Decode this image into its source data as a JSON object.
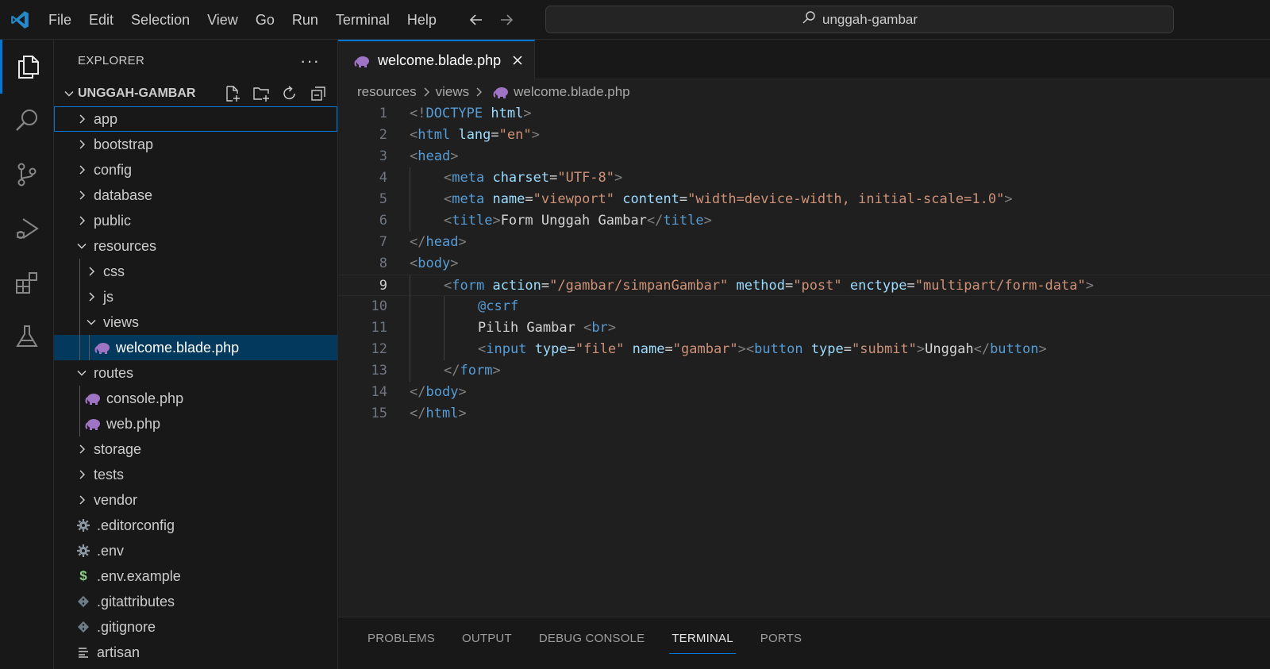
{
  "menu": [
    "File",
    "Edit",
    "Selection",
    "View",
    "Go",
    "Run",
    "Terminal",
    "Help"
  ],
  "search": {
    "text": "unggah-gambar"
  },
  "sidebar": {
    "title": "EXPLORER",
    "more": "···",
    "project": "UNGGAH-GAMBAR",
    "tree": [
      {
        "label": "app",
        "kind": "folder",
        "depth": 0,
        "open": false,
        "focused": true
      },
      {
        "label": "bootstrap",
        "kind": "folder",
        "depth": 0,
        "open": false
      },
      {
        "label": "config",
        "kind": "folder",
        "depth": 0,
        "open": false
      },
      {
        "label": "database",
        "kind": "folder",
        "depth": 0,
        "open": false
      },
      {
        "label": "public",
        "kind": "folder",
        "depth": 0,
        "open": false
      },
      {
        "label": "resources",
        "kind": "folder",
        "depth": 0,
        "open": true
      },
      {
        "label": "css",
        "kind": "folder",
        "depth": 1,
        "open": false
      },
      {
        "label": "js",
        "kind": "folder",
        "depth": 1,
        "open": false
      },
      {
        "label": "views",
        "kind": "folder",
        "depth": 1,
        "open": true
      },
      {
        "label": "welcome.blade.php",
        "kind": "php",
        "depth": 2,
        "selected": true
      },
      {
        "label": "routes",
        "kind": "folder",
        "depth": 0,
        "open": true
      },
      {
        "label": "console.php",
        "kind": "php",
        "depth": 1
      },
      {
        "label": "web.php",
        "kind": "php",
        "depth": 1
      },
      {
        "label": "storage",
        "kind": "folder",
        "depth": 0,
        "open": false
      },
      {
        "label": "tests",
        "kind": "folder",
        "depth": 0,
        "open": false
      },
      {
        "label": "vendor",
        "kind": "folder",
        "depth": 0,
        "open": false
      },
      {
        "label": ".editorconfig",
        "kind": "gear",
        "depth": 0
      },
      {
        "label": ".env",
        "kind": "gear",
        "depth": 0
      },
      {
        "label": ".env.example",
        "kind": "dollar",
        "depth": 0
      },
      {
        "label": ".gitattributes",
        "kind": "git",
        "depth": 0
      },
      {
        "label": ".gitignore",
        "kind": "git",
        "depth": 0
      },
      {
        "label": "artisan",
        "kind": "lines",
        "depth": 0
      }
    ]
  },
  "editor": {
    "tab_label": "welcome.blade.php",
    "breadcrumb": [
      "resources",
      "views",
      "welcome.blade.php"
    ],
    "current_line": 9,
    "lines": [
      {
        "n": "1",
        "indent": 0,
        "tokens": [
          [
            "p",
            "<!"
          ],
          [
            "t",
            "DOCTYPE"
          ],
          [
            "x",
            " "
          ],
          [
            "a",
            "html"
          ],
          [
            "p",
            ">"
          ]
        ]
      },
      {
        "n": "2",
        "indent": 0,
        "tokens": [
          [
            "p",
            "<"
          ],
          [
            "t",
            "html"
          ],
          [
            "x",
            " "
          ],
          [
            "a",
            "lang"
          ],
          [
            "x",
            "="
          ],
          [
            "s",
            "\"en\""
          ],
          [
            "p",
            ">"
          ]
        ]
      },
      {
        "n": "3",
        "indent": 0,
        "tokens": [
          [
            "p",
            "<"
          ],
          [
            "t",
            "head"
          ],
          [
            "p",
            ">"
          ]
        ]
      },
      {
        "n": "4",
        "indent": 1,
        "tokens": [
          [
            "p",
            "<"
          ],
          [
            "t",
            "meta"
          ],
          [
            "x",
            " "
          ],
          [
            "a",
            "charset"
          ],
          [
            "x",
            "="
          ],
          [
            "s",
            "\"UTF-8\""
          ],
          [
            "p",
            ">"
          ]
        ]
      },
      {
        "n": "5",
        "indent": 1,
        "tokens": [
          [
            "p",
            "<"
          ],
          [
            "t",
            "meta"
          ],
          [
            "x",
            " "
          ],
          [
            "a",
            "name"
          ],
          [
            "x",
            "="
          ],
          [
            "s",
            "\"viewport\""
          ],
          [
            "x",
            " "
          ],
          [
            "a",
            "content"
          ],
          [
            "x",
            "="
          ],
          [
            "s",
            "\"width=device-width, initial-scale=1.0\""
          ],
          [
            "p",
            ">"
          ]
        ]
      },
      {
        "n": "6",
        "indent": 1,
        "tokens": [
          [
            "p",
            "<"
          ],
          [
            "t",
            "title"
          ],
          [
            "p",
            ">"
          ],
          [
            "x",
            "Form Unggah Gambar"
          ],
          [
            "p",
            "</"
          ],
          [
            "t",
            "title"
          ],
          [
            "p",
            ">"
          ]
        ]
      },
      {
        "n": "7",
        "indent": 0,
        "tokens": [
          [
            "p",
            "</"
          ],
          [
            "t",
            "head"
          ],
          [
            "p",
            ">"
          ]
        ]
      },
      {
        "n": "8",
        "indent": 0,
        "tokens": [
          [
            "p",
            "<"
          ],
          [
            "t",
            "body"
          ],
          [
            "p",
            ">"
          ]
        ]
      },
      {
        "n": "9",
        "indent": 1,
        "tokens": [
          [
            "p",
            "<"
          ],
          [
            "t",
            "form"
          ],
          [
            "x",
            " "
          ],
          [
            "a",
            "action"
          ],
          [
            "x",
            "="
          ],
          [
            "s",
            "\"/gambar/simpanGambar\""
          ],
          [
            "x",
            " "
          ],
          [
            "a",
            "method"
          ],
          [
            "x",
            "="
          ],
          [
            "s",
            "\"post\""
          ],
          [
            "x",
            " "
          ],
          [
            "a",
            "enctype"
          ],
          [
            "x",
            "="
          ],
          [
            "s",
            "\"multipart/form-data\""
          ],
          [
            "p",
            ">"
          ]
        ]
      },
      {
        "n": "10",
        "indent": 2,
        "tokens": [
          [
            "t",
            "@csrf"
          ]
        ]
      },
      {
        "n": "11",
        "indent": 2,
        "tokens": [
          [
            "x",
            "Pilih Gambar "
          ],
          [
            "p",
            "<"
          ],
          [
            "t",
            "br"
          ],
          [
            "p",
            ">"
          ]
        ]
      },
      {
        "n": "12",
        "indent": 2,
        "tokens": [
          [
            "p",
            "<"
          ],
          [
            "t",
            "input"
          ],
          [
            "x",
            " "
          ],
          [
            "a",
            "type"
          ],
          [
            "x",
            "="
          ],
          [
            "s",
            "\"file\""
          ],
          [
            "x",
            " "
          ],
          [
            "a",
            "name"
          ],
          [
            "x",
            "="
          ],
          [
            "s",
            "\"gambar\""
          ],
          [
            "p",
            "><"
          ],
          [
            "t",
            "button"
          ],
          [
            "x",
            " "
          ],
          [
            "a",
            "type"
          ],
          [
            "x",
            "="
          ],
          [
            "s",
            "\"submit\""
          ],
          [
            "p",
            ">"
          ],
          [
            "x",
            "Unggah"
          ],
          [
            "p",
            "</"
          ],
          [
            "t",
            "button"
          ],
          [
            "p",
            ">"
          ]
        ]
      },
      {
        "n": "13",
        "indent": 1,
        "tokens": [
          [
            "p",
            "</"
          ],
          [
            "t",
            "form"
          ],
          [
            "p",
            ">"
          ]
        ]
      },
      {
        "n": "14",
        "indent": 0,
        "tokens": [
          [
            "p",
            "</"
          ],
          [
            "t",
            "body"
          ],
          [
            "p",
            ">"
          ]
        ]
      },
      {
        "n": "15",
        "indent": 0,
        "tokens": [
          [
            "p",
            "</"
          ],
          [
            "t",
            "html"
          ],
          [
            "p",
            ">"
          ]
        ]
      }
    ]
  },
  "panel": {
    "tabs": [
      "PROBLEMS",
      "OUTPUT",
      "DEBUG CONSOLE",
      "TERMINAL",
      "PORTS"
    ],
    "active": "TERMINAL"
  },
  "colors": {
    "accent": "#0078d4",
    "selection": "#04395e",
    "php_icon": "#a074c4"
  },
  "icons": {
    "activity": [
      "explorer-icon",
      "search-icon",
      "source-control-icon",
      "run-debug-icon",
      "extensions-icon",
      "testing-icon"
    ],
    "project_actions": [
      "new-file-icon",
      "new-folder-icon",
      "refresh-icon",
      "collapse-all-icon"
    ]
  }
}
